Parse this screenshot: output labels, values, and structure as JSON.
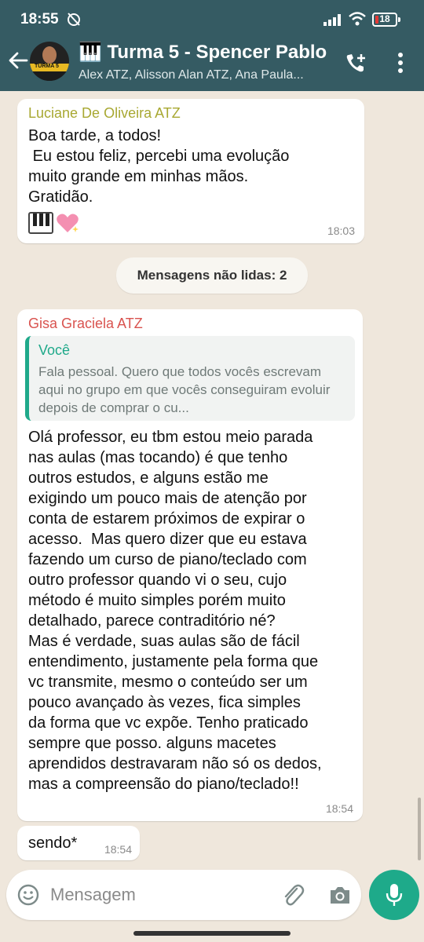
{
  "status": {
    "time": "18:55",
    "battery": "18"
  },
  "header": {
    "title": "🎹 Turma 5 - Spencer Pablo",
    "subtitle": "Alex ATZ, Alisson Alan ATZ, Ana Paula...",
    "avatar_tag": "TURMA 5"
  },
  "messages": [
    {
      "sender": "Luciane De Oliveira ATZ",
      "text": "Boa tarde, a todos!\n Eu estou feliz, percebi uma evolução\nmuito grande em minhas mãos.\nGratidão.",
      "time": "18:03"
    },
    {
      "sender": "Gisa Graciela ATZ",
      "quote_author": "Você",
      "quote_text": "Fala pessoal. Quero que todos vocês escrevam aqui no grupo em que vocês conseguiram evoluir depois de comprar o cu...",
      "text": "Olá professor, eu tbm estou meio parada\nnas aulas (mas tocando) é que tenho\noutros estudos, e alguns estão me\nexigindo um pouco mais de atenção por\nconta de estarem próximos de expirar o\nacesso.  Mas quero dizer que eu estava\nfazendo um curso de piano/teclado com\noutro professor quando vi o seu, cujo\nmétodo é muito simples porém muito\ndetalhado, parece contraditório né?\nMas é verdade, suas aulas são de fácil\nentendimento, justamente pela forma que\nvc transmite, mesmo o conteúdo ser um\npouco avançado às vezes, fica simples\nda forma que vc expõe. Tenho praticado\nsempre que posso. alguns macetes\naprendidos destravaram não só os dedos,\nmas a compreensão do piano/teclado!!",
      "time": "18:54"
    },
    {
      "text": "sendo*",
      "time": "18:54"
    }
  ],
  "unread_label": "Mensagens não lidas: 2",
  "composer": {
    "placeholder": "Mensagem"
  },
  "colors": {
    "header": "#355b63",
    "accent": "#1eaa8a",
    "sender1": "#a8a832",
    "sender2": "#d9534f"
  }
}
